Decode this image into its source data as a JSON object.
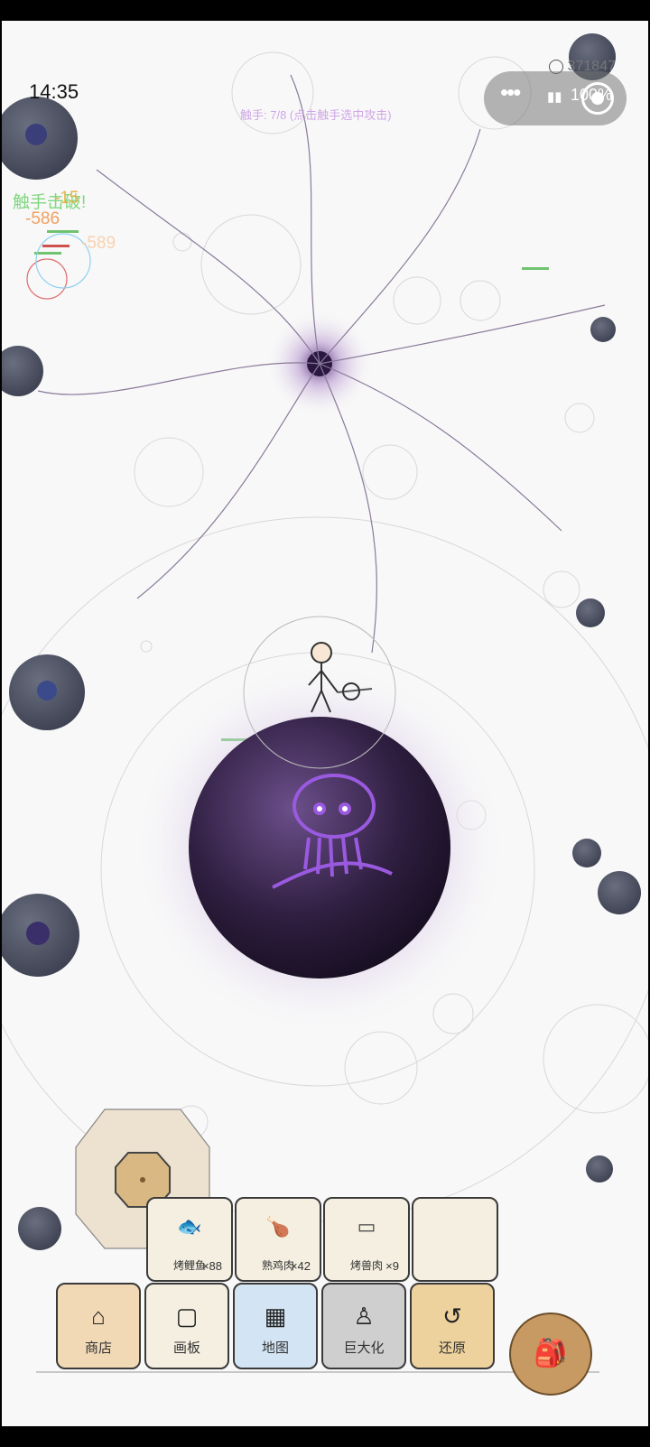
{
  "status_bar": {
    "time": "14:35",
    "battery": "100%"
  },
  "coins": "371847",
  "hint_text": "触手: 7/8 (点击触手选中攻击)",
  "combat_texts": [
    "触手击破!",
    "-15",
    "-586",
    "-589"
  ],
  "inventory": [
    {
      "label": "烤鲤鱼",
      "count": "×88",
      "icon": "grilled-fish-icon",
      "glyph": "🐟"
    },
    {
      "label": "熟鸡肉",
      "count": "×42",
      "icon": "cooked-chicken-icon",
      "glyph": "🍗"
    },
    {
      "label": "烤兽肉",
      "count": "×9",
      "icon": "roast-meat-icon",
      "glyph": "▭"
    },
    {
      "label": "",
      "count": "",
      "icon": "",
      "glyph": ""
    }
  ],
  "nav": [
    {
      "label": "商店",
      "icon": "shop-icon",
      "glyph": "⌂",
      "bg": "#f2d9b6"
    },
    {
      "label": "画板",
      "icon": "drawing-board-icon",
      "glyph": "▢",
      "bg": "#f4efe1"
    },
    {
      "label": "地图",
      "icon": "map-icon",
      "glyph": "▦",
      "bg": "#d3e4f4"
    },
    {
      "label": "巨大化",
      "icon": "giant-icon",
      "glyph": "♙",
      "bg": "#cfcfcf"
    },
    {
      "label": "还原",
      "icon": "restore-icon",
      "glyph": "↺",
      "bg": "#eed29e"
    }
  ],
  "backpack": {
    "icon": "backpack-icon",
    "glyph": "🎒"
  }
}
